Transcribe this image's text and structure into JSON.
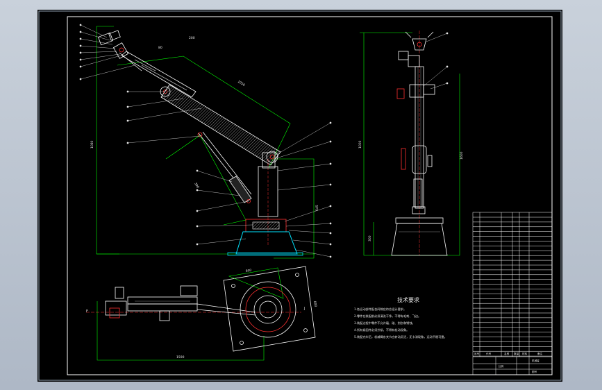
{
  "colors": {
    "viewport_bg": "#b8c2cf",
    "sheet_bg": "#000000",
    "frame": "#ffffff",
    "dimension": "#00ff00",
    "object": "#ffffff",
    "hatch": "#b0b0b0",
    "center_line": "#ff3030",
    "highlight": "#ff3030",
    "base": "#00e5ff",
    "leader": "#e8e8e8"
  },
  "technical_notes": {
    "title": "技术要求",
    "lines": [
      "1.各运动部件配合间隙应符合设计要求。",
      "2.零件在装配前必须清洗干净，不得有毛刺、飞边。",
      "3.装配过程中零件不允许磕、碰、划伤和锈蚀。",
      "4.所有紧固件必须拧紧，不得有松动现象。",
      "5.装配完毕后，机械臂各关节应转动灵活，无卡滞现象，运动平稳可靠。"
    ]
  },
  "main_view": {
    "dimension_labels": [
      "1080",
      "1050",
      "390",
      "545",
      "80",
      "200",
      "1150"
    ]
  },
  "side_view": {
    "dimension_labels": [
      "1000",
      "1600",
      "300"
    ]
  },
  "top_view": {
    "dimension_labels": [
      "1590",
      "600",
      "600"
    ],
    "section_marks": [
      "F",
      "J"
    ]
  },
  "title_block": {
    "labels": [
      "序号",
      "代号",
      "名称",
      "数量",
      "材料",
      "备注",
      "机械臂",
      "比例",
      "图号"
    ]
  }
}
